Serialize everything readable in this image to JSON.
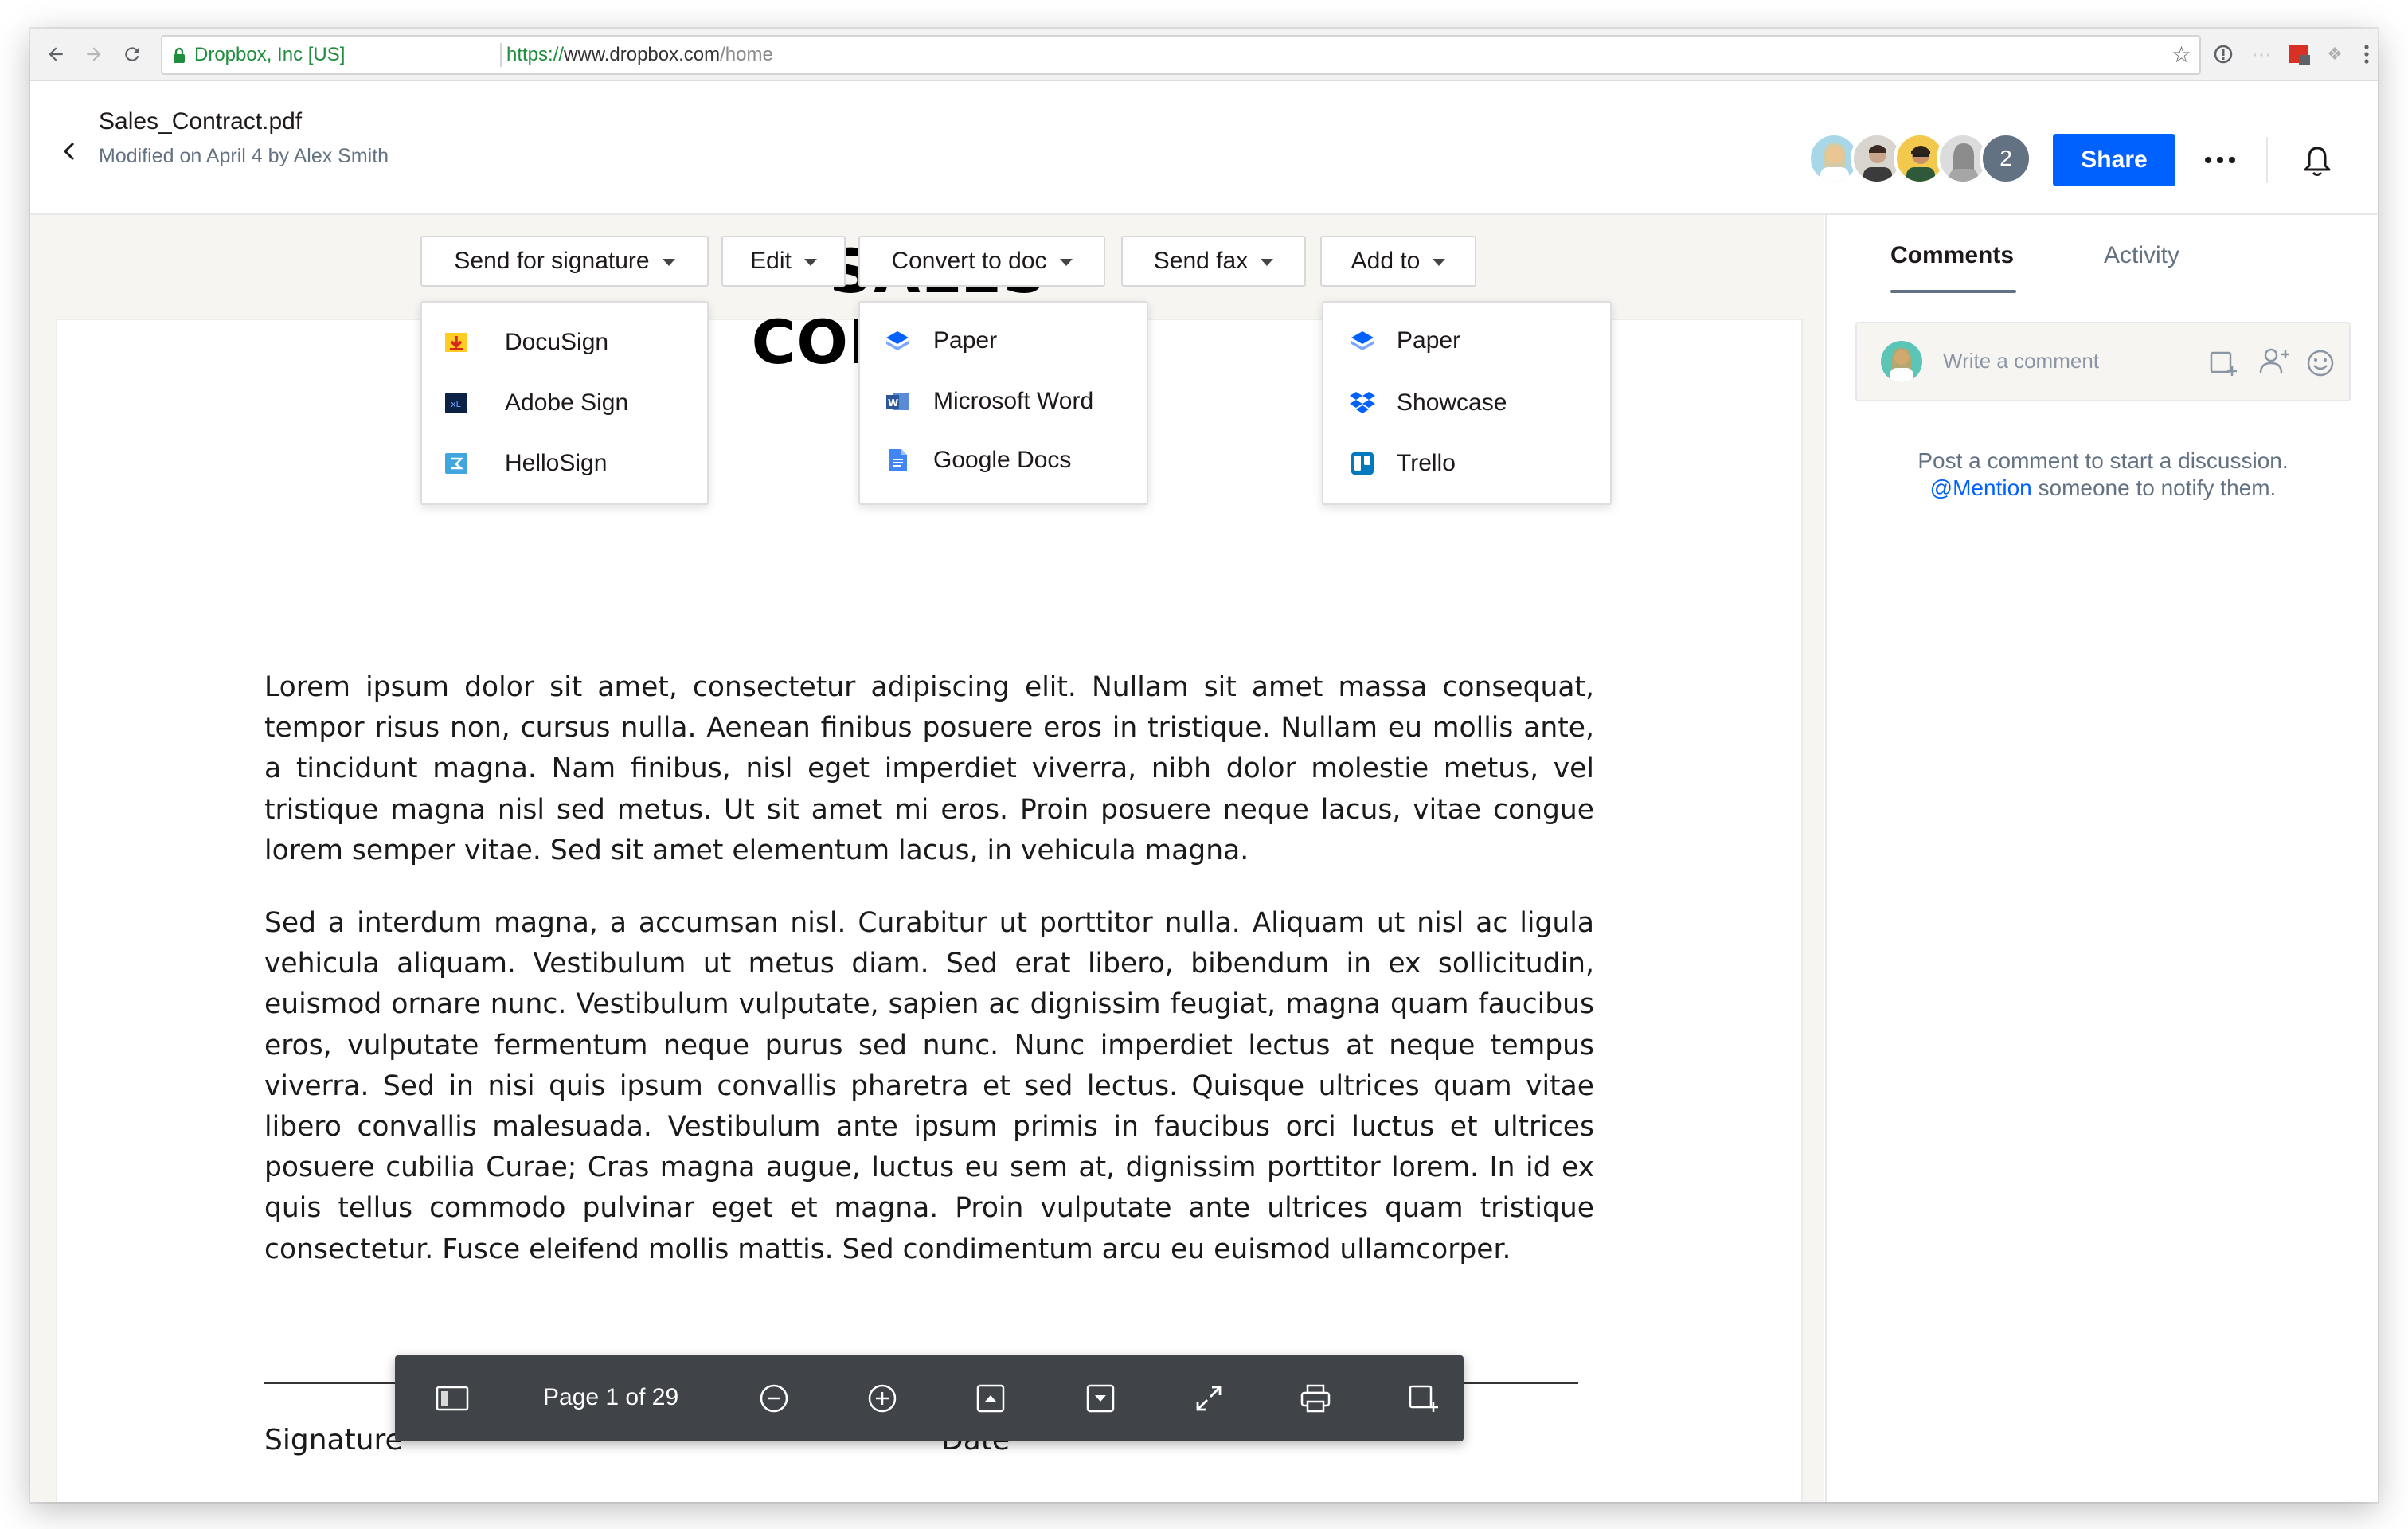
{
  "browser": {
    "site_identity": "Dropbox, Inc [US]",
    "url_protocol": "https://",
    "url_host": "www.dropbox.com",
    "url_path": "/home"
  },
  "header": {
    "file_name": "Sales_Contract.pdf",
    "modified": "Modified on April 4 by Alex Smith",
    "extra_collaborators": "2",
    "share_label": "Share"
  },
  "toolbar": {
    "send_for_signature": "Send for signature",
    "edit": "Edit",
    "convert_to_doc": "Convert to doc",
    "send_fax": "Send fax",
    "add_to": "Add to"
  },
  "menus": {
    "signature": [
      "DocuSign",
      "Adobe Sign",
      "HelloSign"
    ],
    "convert": [
      "Paper",
      "Microsoft Word",
      "Google Docs"
    ],
    "add_to": [
      "Paper",
      "Showcase",
      "Trello"
    ]
  },
  "document": {
    "title": "SALES CONTRACT",
    "para1": "Lorem ipsum dolor sit amet, consectetur adipiscing elit. Nullam sit amet massa consequat, tempor risus non, cursus nulla. Aenean finibus posuere eros in tristique. Nullam eu mollis ante, a tincidunt magna. Nam finibus, nisl eget imperdiet viverra, nibh dolor molestie metus, vel tristique magna nisl sed metus. Ut sit amet mi eros. Proin posuere neque lacus, vitae congue lorem semper vitae. Sed sit amet elementum lacus, in vehicula magna.",
    "para2": "Sed a interdum magna, a accumsan nisl. Curabitur ut porttitor nulla. Aliquam ut nisl ac ligula vehicula aliquam. Vestibulum ut metus diam. Sed erat libero, bibendum in ex sollicitudin, euismod ornare nunc. Vestibulum vulputate, sapien ac dignissim feugiat, magna quam faucibus eros, vulputate fermentum neque purus sed nunc. Nunc imperdiet lectus at neque tempus viverra. Sed in nisi quis ipsum convallis pharetra et sed lectus. Quisque ultrices quam vitae libero convallis malesuada. Vestibulum ante ipsum primis in faucibus orci luctus et ultrices posuere cubilia Curae; Cras magna augue, luctus eu sem at, dignissim porttitor lorem. In id ex quis tellus commodo pulvinar eget et magna. Proin vulputate ante ultrices quam tristique consectetur. Fusce eleifend mollis mattis. Sed condimentum arcu eu euismod ullamcorper.",
    "signature_label": "Signature",
    "date_label": "Date"
  },
  "sidebar": {
    "tab_comments": "Comments",
    "tab_activity": "Activity",
    "comment_placeholder": "Write a comment",
    "empty_line1": "Post a comment to start a discussion.",
    "empty_mention": "@Mention",
    "empty_line2": "someone to notify them."
  },
  "pdf_toolbar": {
    "page_indicator": "Page 1 of 29"
  },
  "colors": {
    "accent": "#0061fe",
    "toolbar_bg": "#404448",
    "canvas_bg": "#f7f5f2"
  }
}
